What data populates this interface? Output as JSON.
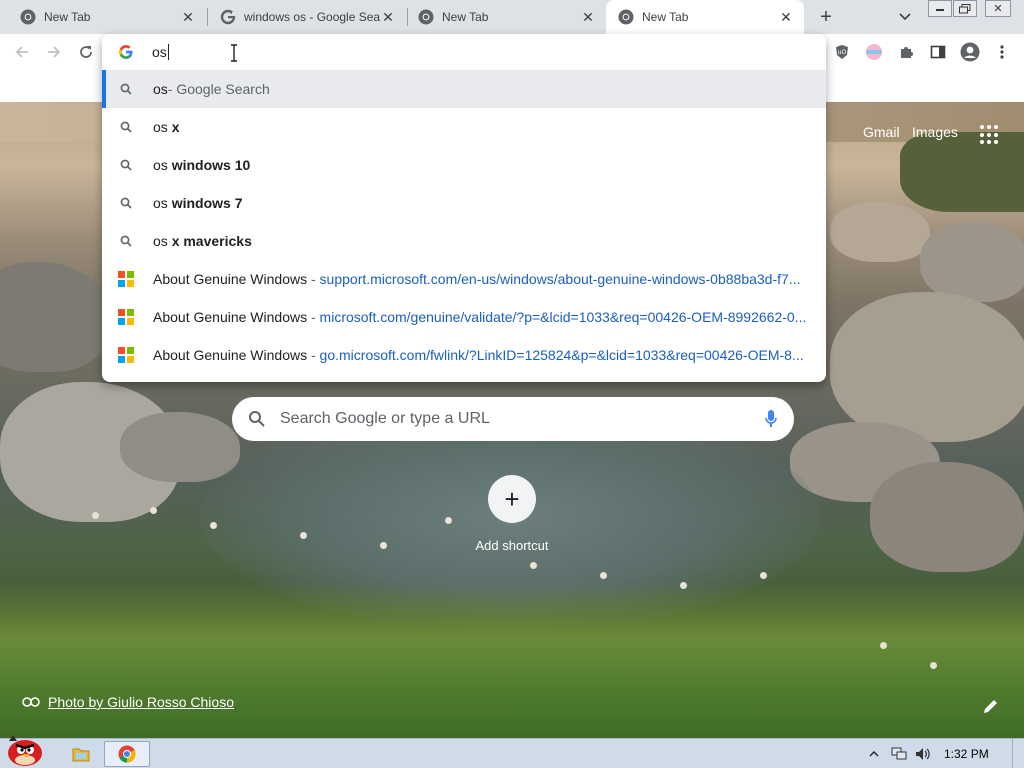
{
  "tabs": [
    {
      "title": "New Tab",
      "icon": "chrome-icon",
      "active": false
    },
    {
      "title": "windows os - Google Sea",
      "icon": "google-icon",
      "active": false
    },
    {
      "title": "New Tab",
      "icon": "chrome-icon",
      "active": false
    },
    {
      "title": "New Tab",
      "icon": "chrome-icon",
      "active": true
    }
  ],
  "omnibox": {
    "value": "os",
    "suggestions": [
      {
        "type": "search",
        "plain": "os",
        "bold": "",
        "suffix": " - Google Search",
        "selected": true
      },
      {
        "type": "search",
        "plain": "os ",
        "bold": "x"
      },
      {
        "type": "search",
        "plain": "os ",
        "bold": "windows 10"
      },
      {
        "type": "search",
        "plain": "os ",
        "bold": "windows 7"
      },
      {
        "type": "search",
        "plain": "os ",
        "bold": "x mavericks"
      },
      {
        "type": "history",
        "title": "About Genuine Windows",
        "sep": " - ",
        "url": "support.microsoft.com/en-us/windows/about-genuine-windows-0b88ba3d-f7..."
      },
      {
        "type": "history",
        "title": "About Genuine Windows",
        "sep": " - ",
        "url": "microsoft.com/genuine/validate/?p=&lcid=1033&req=00426-OEM-8992662-0..."
      },
      {
        "type": "history",
        "title": "About Genuine Windows",
        "sep": " - ",
        "url": "go.microsoft.com/fwlink/?LinkID=125824&p=&lcid=1033&req=00426-OEM-8..."
      }
    ]
  },
  "ntp": {
    "gmail": "Gmail",
    "images": "Images",
    "search_placeholder": "Search Google or type a URL",
    "add_shortcut": "Add shortcut",
    "photo_credit": "Photo by Giulio Rosso Chioso"
  },
  "taskbar": {
    "clock": "1:32 PM"
  },
  "colors": {
    "accent": "#1a73e8",
    "url": "#1a5fbf",
    "ms_red": "#f25022",
    "ms_green": "#7fba00",
    "ms_blue": "#00a4ef",
    "ms_yellow": "#ffb900"
  }
}
